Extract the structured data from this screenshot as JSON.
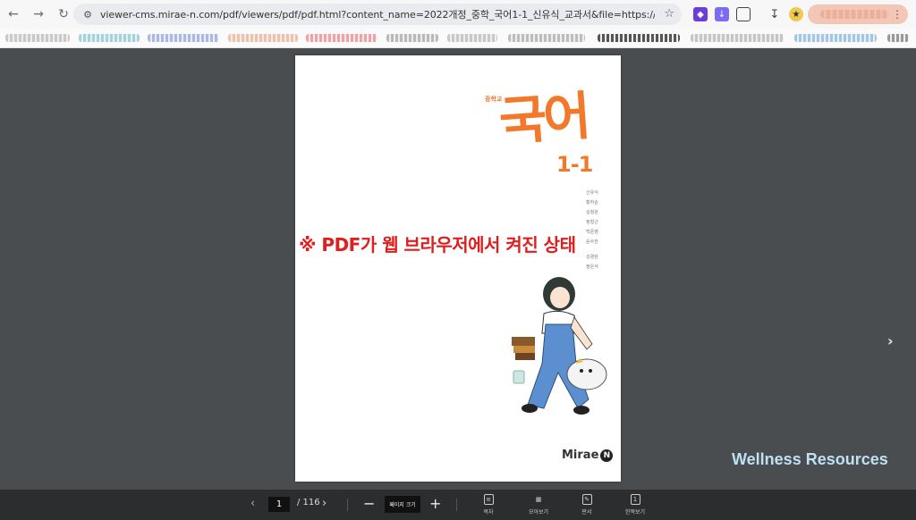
{
  "browser": {
    "url": "viewer-cms.mirae-n.com/pdf/viewers/pdf/pdf.html?content_name=2022개정_중학_국어1-1_신유식_교과서&file=https://privw-cms.mirae-n.com/doc..."
  },
  "document": {
    "small_title": "중학교",
    "title": "국어",
    "grade": "1-1",
    "authors": [
      "신유식",
      "황하순",
      "김청완",
      "정형근",
      "백준영",
      "윤수한",
      "",
      "",
      "",
      "강경란",
      "정은석"
    ],
    "publisher": "Mirae",
    "publisher_badge": "N"
  },
  "overlay": {
    "text": "※ PDF가 웹 브라우저에서 켜진 상태"
  },
  "watermark": "Wellness Resources",
  "viewer_controls": {
    "current_page": "1",
    "total_pages": "/ 116",
    "zoom_label": "페이지 크기",
    "tools": [
      {
        "label": "목차"
      },
      {
        "label": "모아보기"
      },
      {
        "label": "판서"
      },
      {
        "label": "한쪽보기"
      }
    ]
  },
  "colors": {
    "title_orange": "#f2792c",
    "overlay_red": "#e21d1d",
    "viewer_bg": "#4a4d4f",
    "watermark": "#bfe1f3"
  }
}
